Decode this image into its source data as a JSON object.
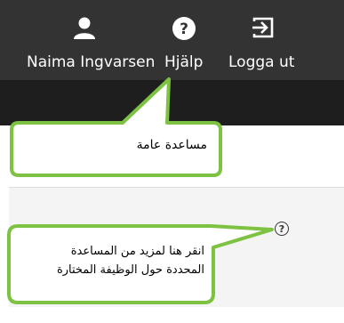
{
  "header": {
    "user": {
      "label": "Naima Ingvarsen",
      "icon": "user-icon"
    },
    "help": {
      "label": "Hjälp",
      "icon": "question-circle-icon"
    },
    "logout": {
      "label": "Logga ut",
      "icon": "sign-out-icon"
    }
  },
  "callouts": {
    "general_help": "مساعدة عامة",
    "specific_help_line1": "انقر هنا لمزيد من المساعدة",
    "specific_help_line2": "المحددة حول الوظيفة المختارة"
  },
  "help_button": {
    "glyph": "?",
    "icon": "question-circle-icon"
  },
  "colors": {
    "topbar": "#333333",
    "subbar": "#1e1e1e",
    "callout_border": "#7dc242",
    "callout_fill": "#ffffff",
    "content_band": "#f4f4f4"
  }
}
